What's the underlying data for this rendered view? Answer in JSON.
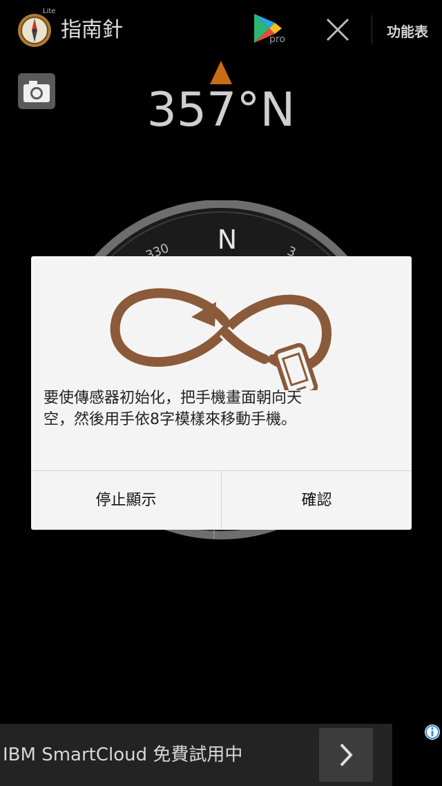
{
  "app_bar": {
    "lite_tag": "Lite",
    "title": "指南針",
    "pro_label": "pro",
    "menu_label": "功能表"
  },
  "compass": {
    "heading_text": "357°N",
    "north_label": "N",
    "tick_330": "330",
    "tick_30": "3"
  },
  "dialog": {
    "message_line1": "要使傳感器初始化，把手機畫面朝向天",
    "message_line2": "空，然後用手依8字模樣來移動手機。",
    "stop_button": "停止顯示",
    "confirm_button": "確認"
  },
  "ad": {
    "text": "IBM SmartCloud 免費試用中"
  },
  "icons": {
    "app": "compass-icon",
    "store": "google-play-icon",
    "close": "close-icon",
    "camera": "camera-icon",
    "calibration": "infinity-phone-icon",
    "ad_arrow": "chevron-right-icon",
    "ad_info": "info-icon"
  },
  "colors": {
    "accent": "#c96b17",
    "infinity": "#8a5a3a",
    "dialog_bg": "#f4f4f4",
    "background": "#000000"
  }
}
